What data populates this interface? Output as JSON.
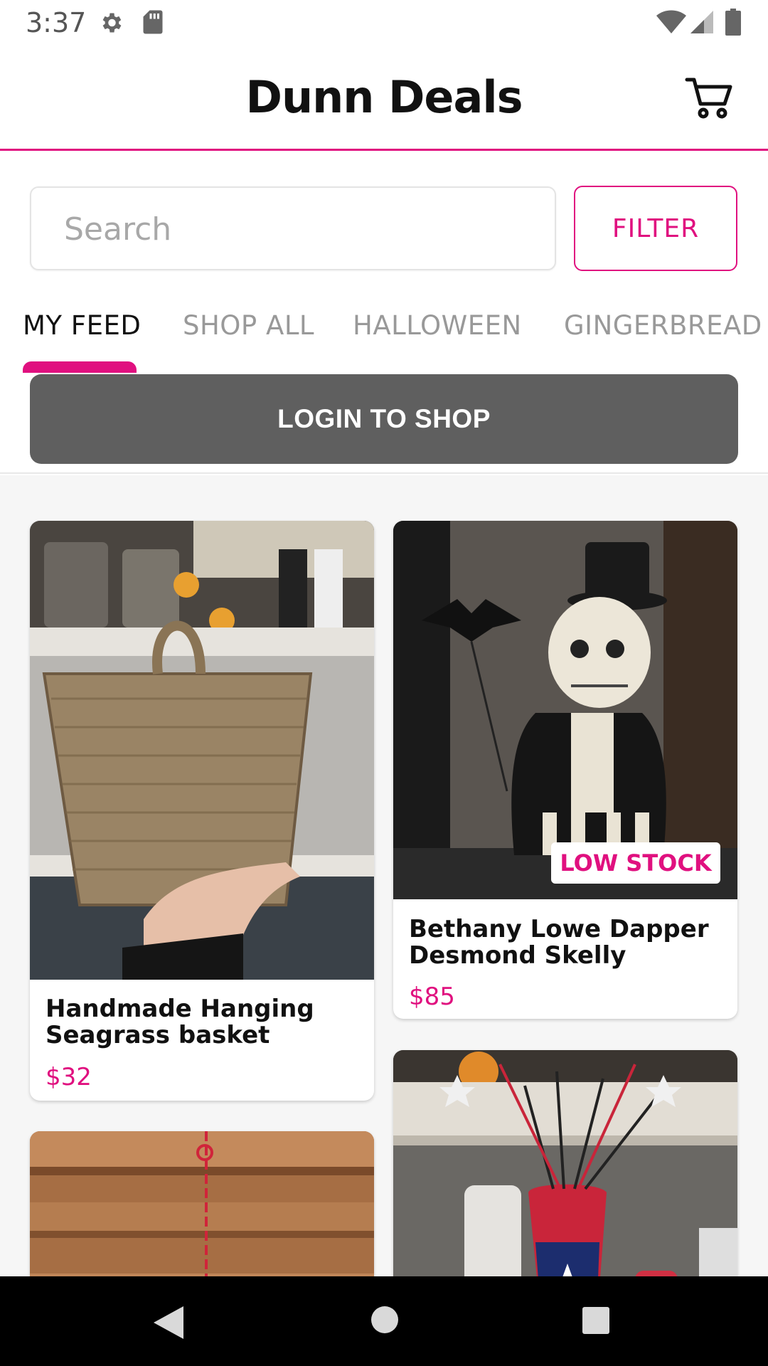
{
  "status_bar": {
    "time": "3:37",
    "icons": [
      "gear-icon",
      "sd-card-icon",
      "wifi-icon",
      "signal-icon",
      "battery-icon"
    ]
  },
  "app_bar": {
    "title": "Dunn Deals",
    "cart_icon": "cart-icon"
  },
  "search": {
    "placeholder": "Search",
    "value": ""
  },
  "filter": {
    "label": "FILTER"
  },
  "tabs": [
    {
      "label": "MY FEED",
      "active": true
    },
    {
      "label": "SHOP ALL",
      "active": false
    },
    {
      "label": "HALLOWEEN",
      "active": false
    },
    {
      "label": "GINGERBREAD H",
      "active": false
    }
  ],
  "login": {
    "label": "LOGIN TO SHOP"
  },
  "products": [
    {
      "title": "Handmade Hanging Seagrass basket",
      "price": "$32",
      "badge": ""
    },
    {
      "title": "Bethany Lowe Dapper Desmond Skelly",
      "price": "$85",
      "badge": "LOW STOCK"
    },
    {
      "title": "",
      "price": "",
      "badge": ""
    },
    {
      "title": "",
      "price": "",
      "badge": ""
    }
  ],
  "colors": {
    "accent": "#e0107f",
    "login_button": "#5f5f5f",
    "feed_background": "#f6f6f6"
  },
  "nav_bar": {
    "icons": [
      "back-icon",
      "home-icon",
      "recents-icon"
    ]
  }
}
